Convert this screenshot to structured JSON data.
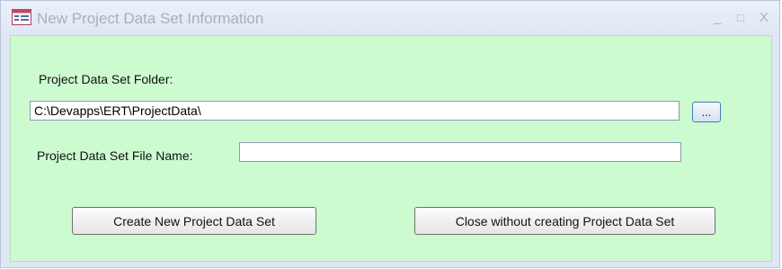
{
  "window": {
    "title": "New Project Data Set Information",
    "controls": {
      "minimize": "_",
      "maximize": "□",
      "close": "X"
    },
    "colors": {
      "client_background": "#cdfbd0",
      "frame": "#dfe7f4"
    }
  },
  "form": {
    "folder_label": "Project Data Set Folder:",
    "folder_value": "C:\\Devapps\\ERT\\ProjectData\\",
    "browse_label": "...",
    "filename_label": "Project Data Set File Name:",
    "filename_value": ""
  },
  "buttons": {
    "create_label": "Create New Project Data Set",
    "close_label": "Close without creating Project Data Set"
  }
}
